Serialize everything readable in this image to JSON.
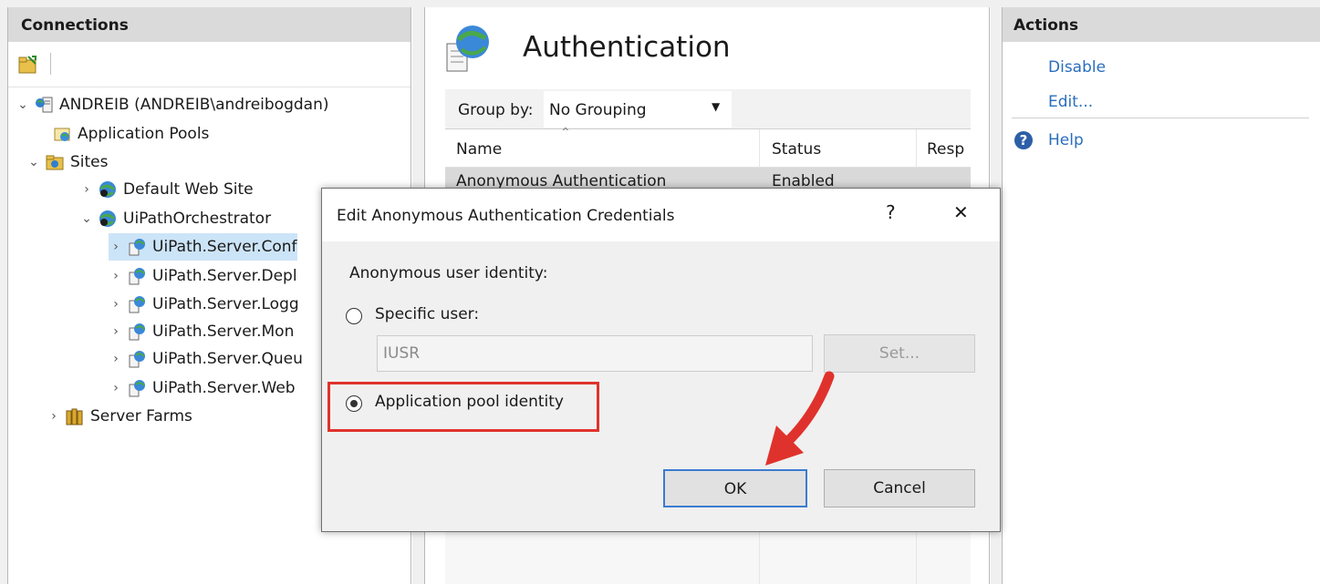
{
  "connections": {
    "title": "Connections",
    "tree": {
      "server": "ANDREIB (ANDREIB\\andreibogdan)",
      "app_pools": "Application Pools",
      "sites": "Sites",
      "default_site": "Default Web Site",
      "orchestrator": "UiPathOrchestrator",
      "children": [
        "UiPath.Server.Conf",
        "UiPath.Server.Depl",
        "UiPath.Server.Logg",
        "UiPath.Server.Mon",
        "UiPath.Server.Queu",
        "UiPath.Server.Web"
      ],
      "server_farms": "Server Farms"
    }
  },
  "center": {
    "title": "Authentication",
    "group_by_label": "Group by:",
    "group_by_value": "No Grouping",
    "columns": [
      "Name",
      "Status",
      "Resp"
    ],
    "row": {
      "name": "Anonymous Authentication",
      "status": "Enabled"
    }
  },
  "actions": {
    "title": "Actions",
    "disable": "Disable",
    "edit": "Edit...",
    "help": "Help"
  },
  "dialog": {
    "title": "Edit Anonymous Authentication Credentials",
    "help_glyph": "?",
    "close_glyph": "✕",
    "identity_label": "Anonymous user identity:",
    "specific_user_label": "Specific user:",
    "specific_user_value": "IUSR",
    "set_button": "Set...",
    "app_pool_label": "Application pool identity",
    "selected_option": "Application pool identity",
    "ok_button": "OK",
    "cancel_button": "Cancel"
  },
  "colors": {
    "accent": "#2a6ebd",
    "highlight_box": "#e0322c",
    "arrow": "#e0322c",
    "selection": "#cce4f7"
  }
}
